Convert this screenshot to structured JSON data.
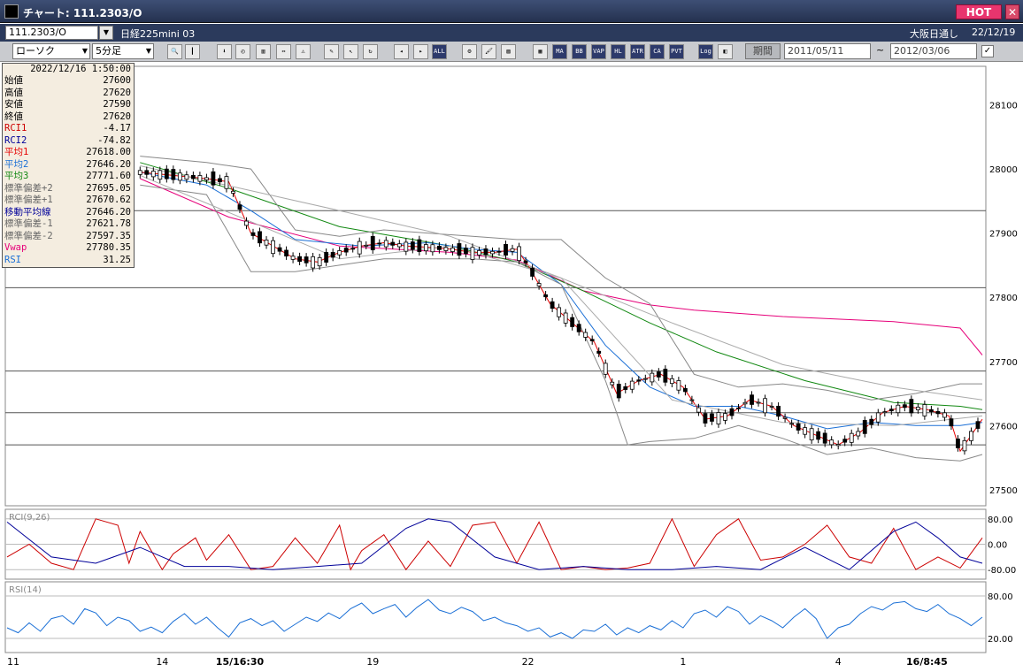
{
  "window": {
    "title": "チャート: 111.2303/O",
    "hot_label": "HOT",
    "close_label": "✕"
  },
  "infobar": {
    "symbol": "111.2303/O",
    "name": "日経225mini 03",
    "exchange": "大阪日通し",
    "date": "22/12/19"
  },
  "toolbar": {
    "chart_type": "ローソク",
    "interval": "5分足",
    "buttons": [
      {
        "name": "zoom-icon",
        "label": "🔍"
      },
      {
        "name": "column-icon",
        "label": "┃"
      },
      {
        "name": "download-icon",
        "label": "⬇"
      },
      {
        "name": "clock-icon",
        "label": "◴"
      },
      {
        "name": "scale-icon",
        "label": "▥"
      },
      {
        "name": "arrows-icon",
        "label": "⇔"
      },
      {
        "name": "warning-icon",
        "label": "⚠"
      },
      {
        "name": "pen-icon",
        "label": "✎"
      },
      {
        "name": "cursor-icon",
        "label": "↖"
      },
      {
        "name": "refresh-icon",
        "label": "↻"
      },
      {
        "name": "candle-left-icon",
        "label": "◂"
      },
      {
        "name": "candle-right-icon",
        "label": "▸"
      },
      {
        "name": "all-icon",
        "label": "ALL"
      },
      {
        "name": "gear-icon",
        "label": "⚙"
      },
      {
        "name": "brush-icon",
        "label": "🖌"
      },
      {
        "name": "palette-icon",
        "label": "▨"
      },
      {
        "name": "grid-icon",
        "label": "▦"
      },
      {
        "name": "ma-icon",
        "label": "MA"
      },
      {
        "name": "bb-icon",
        "label": "BB"
      },
      {
        "name": "vwap-icon",
        "label": "VAP"
      },
      {
        "name": "hl-icon",
        "label": "HL"
      },
      {
        "name": "atr-icon",
        "label": "ATR"
      },
      {
        "name": "ca-icon",
        "label": "CA"
      },
      {
        "name": "pvt-icon",
        "label": "PVT"
      },
      {
        "name": "log-icon",
        "label": "Log"
      },
      {
        "name": "split-icon",
        "label": "◧"
      }
    ],
    "period_label": "期間",
    "date_from": "2011/05/11",
    "tilde": "~",
    "date_to": "2012/03/06",
    "checkbox_mark": "✓"
  },
  "legend": {
    "datetime": "2022/12/16 1:50:00",
    "rows": [
      {
        "label": "始値",
        "value": "27600",
        "color": "#000000"
      },
      {
        "label": "高値",
        "value": "27620",
        "color": "#000000"
      },
      {
        "label": "安値",
        "value": "27590",
        "color": "#000000"
      },
      {
        "label": "終値",
        "value": "27620",
        "color": "#000000"
      },
      {
        "label": "RCI1",
        "value": "-4.17",
        "color": "#cc0000"
      },
      {
        "label": "RCI2",
        "value": "-74.82",
        "color": "#000099"
      },
      {
        "label": "平均1",
        "value": "27618.00",
        "color": "#e60000"
      },
      {
        "label": "平均2",
        "value": "27646.20",
        "color": "#1a6fd6"
      },
      {
        "label": "平均3",
        "value": "27771.60",
        "color": "#118811"
      },
      {
        "label": "標準偏差+2",
        "value": "27695.05",
        "color": "#666666"
      },
      {
        "label": "標準偏差+1",
        "value": "27670.62",
        "color": "#666666"
      },
      {
        "label": "移動平均線",
        "value": "27646.20",
        "color": "#000099"
      },
      {
        "label": "標準偏差-1",
        "value": "27621.78",
        "color": "#666666"
      },
      {
        "label": "標準偏差-2",
        "value": "27597.35",
        "color": "#666666"
      },
      {
        "label": "Vwap",
        "value": "27780.35",
        "color": "#e6007a"
      },
      {
        "label": "RSI",
        "value": "31.25",
        "color": "#1a6fd6"
      }
    ]
  },
  "chart_data": {
    "type": "line",
    "price_axis": {
      "ticks": [
        28100,
        28000,
        27900,
        27800,
        27700,
        27600,
        27500
      ],
      "ylim": [
        27475,
        28160
      ]
    },
    "x_labels": [
      {
        "text": "11",
        "bold": false,
        "at": 0
      },
      {
        "text": "14",
        "bold": false,
        "at": 14
      },
      {
        "text": "15/16:30",
        "bold": true,
        "at": 21
      },
      {
        "text": "19",
        "bold": false,
        "at": 33
      },
      {
        "text": "22",
        "bold": false,
        "at": 47
      },
      {
        "text": "1",
        "bold": false,
        "at": 61
      },
      {
        "text": "4",
        "bold": false,
        "at": 75
      },
      {
        "text": "16/8:45",
        "bold": true,
        "at": 83
      }
    ],
    "horizontal_lines": [
      27935,
      27815,
      27685,
      27620,
      27570
    ],
    "series": [
      {
        "name": "Vwap",
        "color": "#e6007a",
        "x": [
          12,
          20,
          30,
          40,
          46,
          52,
          58,
          62,
          70,
          80,
          86,
          88
        ],
        "y": [
          27985,
          27925,
          27880,
          27870,
          27858,
          27810,
          27788,
          27780,
          27770,
          27762,
          27752,
          27710
        ]
      },
      {
        "name": "平均3",
        "color": "#118811",
        "x": [
          12,
          20,
          30,
          40,
          46,
          52,
          58,
          64,
          72,
          80,
          86,
          88
        ],
        "y": [
          28010,
          27970,
          27910,
          27880,
          27855,
          27810,
          27760,
          27715,
          27670,
          27636,
          27630,
          27625
        ]
      },
      {
        "name": "平均2",
        "color": "#1a6fd6",
        "x": [
          12,
          18,
          22,
          26,
          32,
          38,
          42,
          46,
          50,
          54,
          58,
          62,
          66,
          70,
          74,
          78,
          82,
          86,
          88
        ],
        "y": [
          27995,
          27975,
          27935,
          27890,
          27880,
          27885,
          27875,
          27870,
          27820,
          27725,
          27660,
          27630,
          27630,
          27615,
          27595,
          27605,
          27600,
          27600,
          27605
        ]
      },
      {
        "name": "平均1",
        "color": "#e60000",
        "x": [
          12,
          18,
          20,
          22,
          24,
          26,
          28,
          30,
          32,
          34,
          36,
          38,
          40,
          42,
          44,
          46,
          47,
          49,
          51,
          53,
          55,
          57,
          59,
          61,
          63,
          65,
          67,
          69,
          71,
          73,
          75,
          77,
          79,
          81,
          83,
          85,
          86,
          87,
          88
        ],
        "y": [
          27995,
          27985,
          27980,
          27900,
          27880,
          27860,
          27855,
          27870,
          27880,
          27885,
          27880,
          27878,
          27875,
          27870,
          27870,
          27875,
          27850,
          27790,
          27760,
          27730,
          27650,
          27670,
          27680,
          27660,
          27610,
          27615,
          27640,
          27630,
          27600,
          27585,
          27570,
          27590,
          27620,
          27630,
          27625,
          27615,
          27560,
          27585,
          27610
        ]
      },
      {
        "name": "標準偏差+2",
        "color": "#888888",
        "x": [
          12,
          18,
          22,
          26,
          30,
          34,
          38,
          42,
          46,
          50,
          54,
          58,
          62,
          66,
          70,
          74,
          78,
          82,
          86,
          88
        ],
        "y": [
          28020,
          28010,
          28000,
          27905,
          27895,
          27905,
          27900,
          27895,
          27890,
          27890,
          27830,
          27790,
          27680,
          27660,
          27665,
          27655,
          27640,
          27650,
          27665,
          27665
        ]
      },
      {
        "name": "標準偏差-2",
        "color": "#888888",
        "x": [
          12,
          18,
          20,
          22,
          26,
          30,
          34,
          38,
          42,
          46,
          50,
          54,
          56,
          58,
          62,
          66,
          70,
          74,
          78,
          82,
          86,
          88
        ],
        "y": [
          27975,
          27960,
          27900,
          27840,
          27840,
          27850,
          27860,
          27860,
          27860,
          27855,
          27820,
          27670,
          27570,
          27575,
          27580,
          27600,
          27580,
          27555,
          27565,
          27550,
          27545,
          27555
        ]
      },
      {
        "name": "標準偏差+1",
        "color": "#aaaaaa",
        "x": [
          12,
          30,
          40,
          50,
          60,
          70,
          80,
          88
        ],
        "y": [
          28005,
          27935,
          27895,
          27830,
          27760,
          27695,
          27660,
          27640
        ]
      },
      {
        "name": "標準偏差-1",
        "color": "#aaaaaa",
        "x": [
          12,
          30,
          40,
          50,
          60,
          70,
          80,
          88
        ],
        "y": [
          27990,
          27860,
          27880,
          27830,
          27640,
          27605,
          27600,
          27615
        ]
      }
    ],
    "rci_panel": {
      "label": "RCI(9,26)",
      "ticks": [
        80,
        0,
        -80
      ],
      "tick_labels": [
        "80.00",
        "0.00",
        "-80.00"
      ],
      "ylim": [
        -110,
        110
      ],
      "series": [
        {
          "name": "RCI1",
          "color": "#cc0000",
          "x": [
            0,
            2,
            4,
            6,
            8,
            10,
            11,
            12,
            14,
            15,
            17,
            18,
            20,
            22,
            24,
            26,
            28,
            30,
            31,
            32,
            34,
            36,
            38,
            40,
            42,
            44,
            46,
            48,
            50,
            52,
            54,
            56,
            58,
            60,
            62,
            64,
            66,
            68,
            70,
            72,
            74,
            76,
            78,
            80,
            82,
            84,
            86,
            88
          ],
          "y": [
            -40,
            0,
            -60,
            -80,
            80,
            60,
            -60,
            40,
            -80,
            -30,
            20,
            -50,
            30,
            -80,
            -70,
            20,
            -60,
            60,
            -80,
            -20,
            30,
            -80,
            10,
            -70,
            60,
            70,
            -60,
            70,
            -80,
            -70,
            -80,
            -75,
            -60,
            80,
            -70,
            30,
            80,
            -50,
            -40,
            0,
            60,
            -40,
            -60,
            50,
            -80,
            -40,
            -75,
            20
          ]
        },
        {
          "name": "RCI2",
          "color": "#000099",
          "x": [
            0,
            4,
            8,
            12,
            16,
            20,
            24,
            28,
            32,
            36,
            38,
            40,
            44,
            48,
            52,
            56,
            60,
            64,
            68,
            72,
            76,
            80,
            82,
            84,
            86,
            88
          ],
          "y": [
            70,
            -40,
            -60,
            -10,
            -70,
            -70,
            -80,
            -70,
            -60,
            50,
            80,
            70,
            -40,
            -80,
            -70,
            -80,
            -80,
            -70,
            -80,
            -10,
            -80,
            40,
            70,
            20,
            -40,
            -60
          ]
        }
      ]
    },
    "rsi_panel": {
      "label": "RSI(14)",
      "ticks": [
        80,
        20
      ],
      "tick_labels": [
        "80.00",
        "20.00"
      ],
      "ylim": [
        0,
        100
      ],
      "series": [
        {
          "name": "RSI",
          "color": "#1a6fd6",
          "x": [
            0,
            1,
            2,
            3,
            4,
            5,
            6,
            7,
            8,
            9,
            10,
            11,
            12,
            13,
            14,
            15,
            16,
            17,
            18,
            19,
            20,
            21,
            22,
            23,
            24,
            25,
            26,
            27,
            28,
            29,
            30,
            31,
            32,
            33,
            34,
            35,
            36,
            37,
            38,
            39,
            40,
            41,
            42,
            43,
            44,
            45,
            46,
            47,
            48,
            49,
            50,
            51,
            52,
            53,
            54,
            55,
            56,
            57,
            58,
            59,
            60,
            61,
            62,
            63,
            64,
            65,
            66,
            67,
            68,
            69,
            70,
            71,
            72,
            73,
            74,
            75,
            76,
            77,
            78,
            79,
            80,
            81,
            82,
            83,
            84,
            85,
            86,
            87,
            88
          ],
          "y": [
            35,
            28,
            42,
            30,
            48,
            52,
            40,
            62,
            56,
            38,
            50,
            45,
            30,
            36,
            28,
            44,
            55,
            40,
            50,
            35,
            22,
            42,
            48,
            38,
            45,
            30,
            40,
            50,
            44,
            56,
            48,
            62,
            70,
            55,
            62,
            68,
            50,
            64,
            75,
            60,
            55,
            64,
            58,
            45,
            50,
            42,
            38,
            30,
            35,
            22,
            28,
            20,
            32,
            30,
            40,
            25,
            35,
            28,
            38,
            32,
            45,
            35,
            55,
            60,
            50,
            65,
            58,
            40,
            52,
            45,
            35,
            50,
            62,
            48,
            20,
            35,
            40,
            55,
            65,
            60,
            70,
            72,
            62,
            58,
            68,
            55,
            48,
            38,
            50
          ]
        }
      ]
    }
  }
}
